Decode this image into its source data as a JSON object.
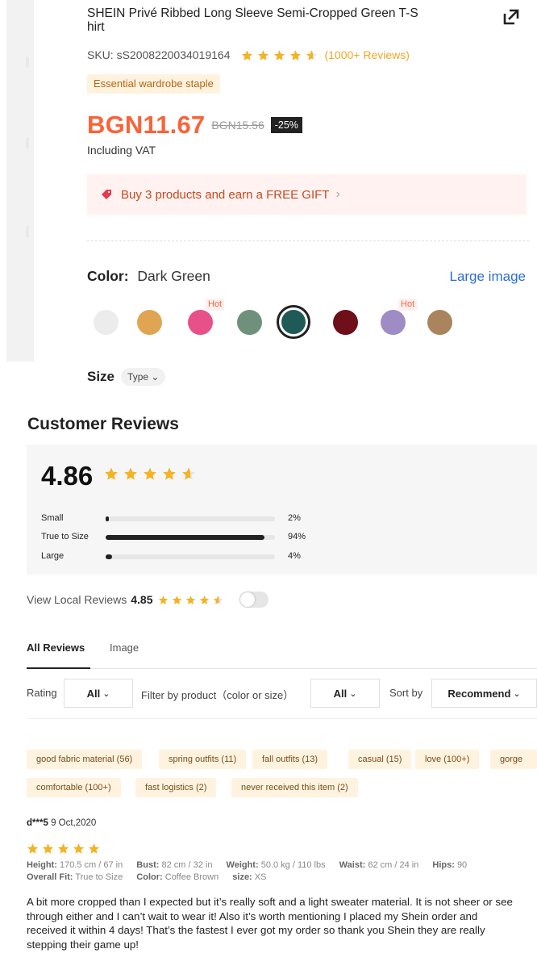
{
  "product": {
    "title": "SHEIN Privé Ribbed Long Sleeve Semi-Cropped Green T-Shirt",
    "title_line1": "SHEIN Privé Ribbed Long Sleeve Semi-Cropped Green T-S",
    "title_line2": "hirt",
    "sku": "SKU: sS2008220034019164",
    "rating_stars": 4.86,
    "reviews_count": "(1000+ Reviews)",
    "staple_badge": "Essential wardrobe staple",
    "price": "BGN11.67",
    "original_price": "BGN15.56",
    "discount": "-25%",
    "vat_note": "Including VAT",
    "gift_promo": "Buy 3 products and earn a FREE GIFT",
    "gift_chevron": "›",
    "color_label": "Color:",
    "color_value": "Dark Green",
    "large_image": "Large image",
    "swatches": [
      {
        "name": "white",
        "color": "#ececec",
        "hot": false
      },
      {
        "name": "mustard",
        "color": "#e0a552",
        "hot": false
      },
      {
        "name": "hot-pink",
        "color": "#e8508a",
        "hot": true
      },
      {
        "name": "sage-green",
        "color": "#6f917c",
        "hot": false
      },
      {
        "name": "dark-green",
        "color": "#1f5a56",
        "hot": false,
        "selected": true
      },
      {
        "name": "burgundy",
        "color": "#6e0f1a",
        "hot": false
      },
      {
        "name": "lilac",
        "color": "#a08cc4",
        "hot": true
      },
      {
        "name": "coffee-brown",
        "color": "#a9845d",
        "hot": false
      }
    ],
    "hot_label": "Hot",
    "size_label": "Size",
    "type_button": "Type",
    "type_chevron": "⌄"
  },
  "reviews": {
    "section_title": "Customer Reviews",
    "overall_score": "4.86",
    "fit": [
      {
        "label": "Small",
        "percent": 2,
        "percent_text": "2%"
      },
      {
        "label": "True to Size",
        "percent": 94,
        "percent_text": "94%"
      },
      {
        "label": "Large",
        "percent": 4,
        "percent_text": "4%"
      }
    ],
    "local_label": "View Local Reviews",
    "local_score": "4.85",
    "tabs": [
      "All Reviews",
      "Image"
    ],
    "filters": {
      "rating_label": "Rating",
      "rating_value": "All",
      "product_label": "Filter by product（color or size）",
      "product_value": "All",
      "sort_label": "Sort by",
      "sort_value": "Recommend",
      "chevron": "⌄"
    },
    "tags_row1": [
      "good fabric material (56)",
      "spring outfits (11)",
      "fall outfits (13)",
      "casual (15)",
      "love (100+)",
      "gorge"
    ],
    "tags_row2": [
      "comfortable (100+)",
      "fast logistics (2)",
      "never received this item (2)"
    ],
    "items": [
      {
        "user": "d***5",
        "date": "9 Oct,2020",
        "stars": 5,
        "height_label": "Height:",
        "height": "170.5 cm / 67 in",
        "bust_label": "Bust:",
        "bust": "82 cm / 32 in",
        "weight_label": "Weight:",
        "weight": "50.0 kg / 110 lbs",
        "waist_label": "Waist:",
        "waist": "62 cm / 24 in",
        "hips_label": "Hips:",
        "hips": "90",
        "fit_label": "Overall Fit:",
        "fit": "True to Size",
        "color_label": "Color:",
        "color": "Coffee Brown",
        "size_label": "size:",
        "size": "XS",
        "text": "A bit more cropped than I expected but it’s really soft and a light sweater material. It is not sheer or see through either and I can’t wait to wear it! Also it’s worth mentioning I placed my Shein order and received it within 4 days! That’s the fastest I ever got my order so thank you Shein they are really stepping their game up!"
      }
    ]
  },
  "colors": {
    "price": "#fa6338",
    "star": "#f5b223",
    "link": "#2c6ed6"
  }
}
